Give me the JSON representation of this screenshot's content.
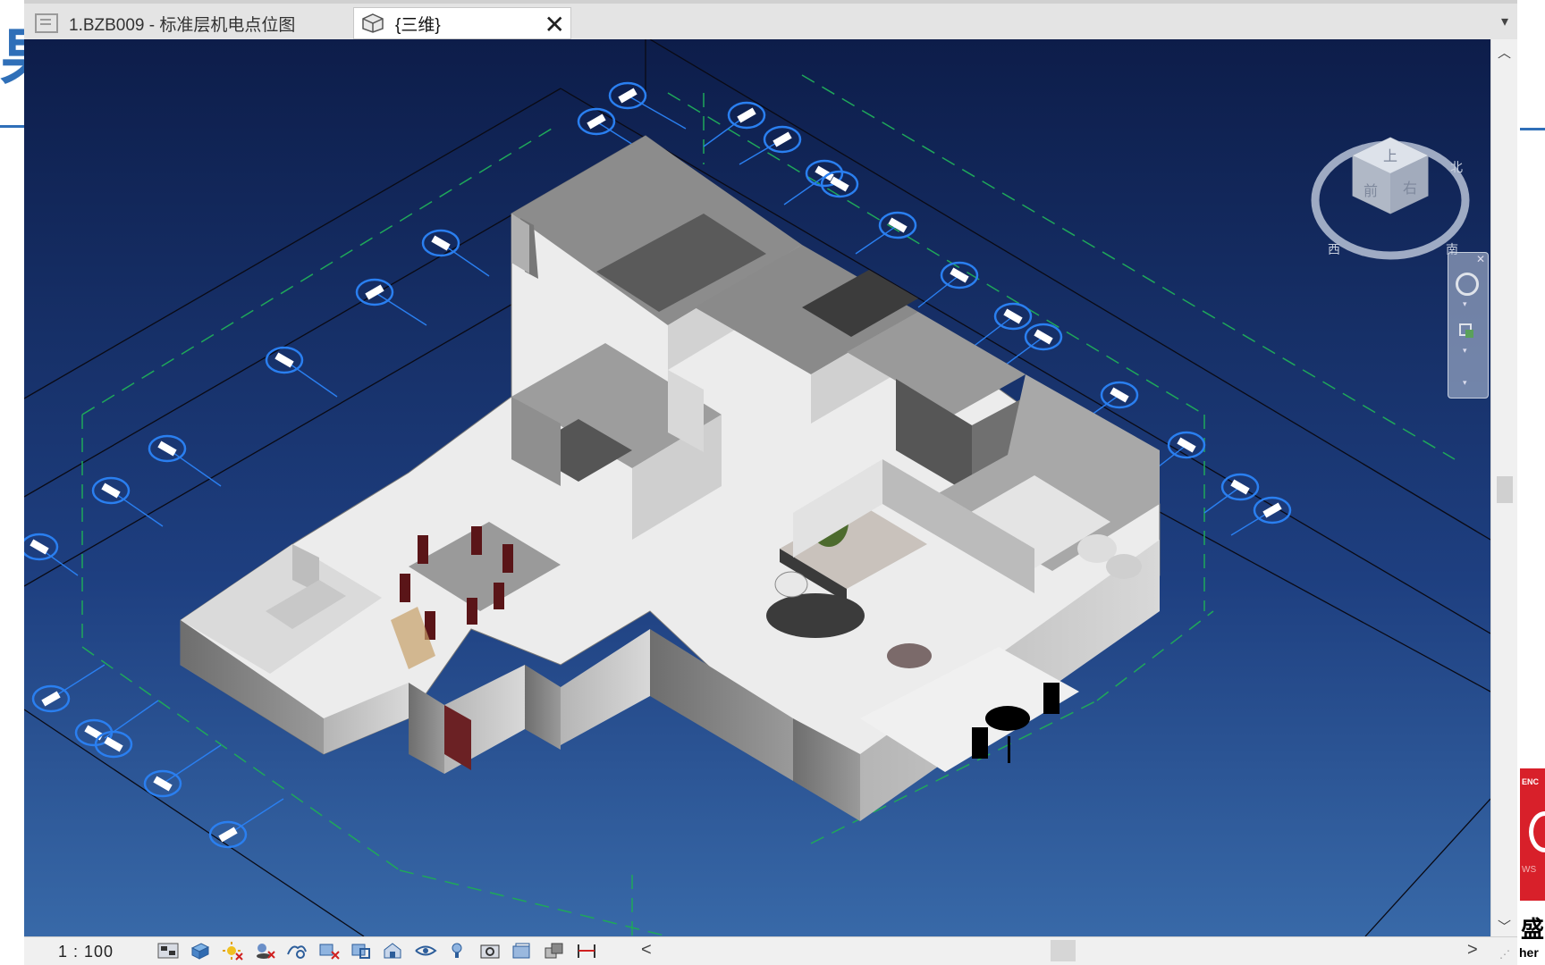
{
  "tabs": [
    {
      "label": "1.BZB009 - 标准层机电点位图",
      "active": false
    },
    {
      "label": "{三维}",
      "active": true
    }
  ],
  "tab_close_symbol": "✕",
  "tab_menu_symbol": "▾",
  "viewport": {
    "background_top": "#0d1d4a",
    "background_bottom": "#3869a8",
    "grid_bubble_color": "#2a7ff0",
    "model_floor_color": "#efefef",
    "model_wall_color": "#8b8b8b"
  },
  "viewcube": {
    "face_top": "上",
    "face_front": "前",
    "face_right": "右",
    "compass_left": "西",
    "compass_right": "南",
    "compass_top": "北"
  },
  "status": {
    "scale": "1 : 100",
    "icons": [
      "detail-level-icon",
      "visual-style-icon",
      "sun-path-icon",
      "shadows-icon",
      "rendering-icon",
      "crop-view-icon",
      "show-crop-icon",
      "unlock-3d-view-icon",
      "temporary-hide-icon",
      "reveal-hidden-icon",
      "temporary-view-properties-icon",
      "hide-analytical-icon",
      "highlight-displacement-icon",
      "reveal-constraints-icon"
    ],
    "scroll_left": "<",
    "scroll_right": ">"
  },
  "right_edge": {
    "badge_text_top": "ENC",
    "badge_text_bottom": "WS",
    "black_text": "盛",
    "black_sub": "her"
  },
  "left_edge": {
    "blue_glyph": "果"
  }
}
